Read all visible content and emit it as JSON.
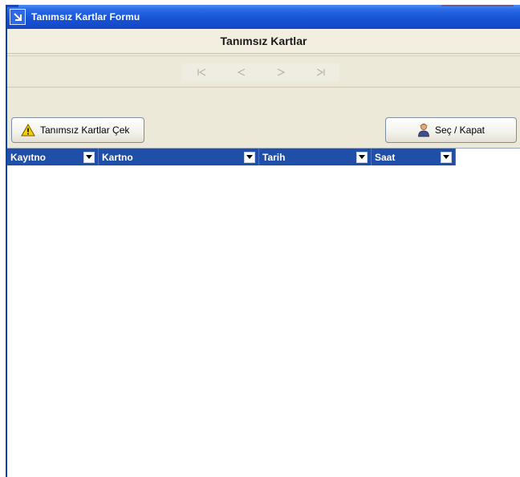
{
  "window": {
    "title": "Tanımsız Kartlar Formu",
    "icon": "arrow-down-right-icon"
  },
  "header": {
    "title": "Tanımsız Kartlar"
  },
  "navigator": {
    "buttons": [
      {
        "name": "first-record-icon"
      },
      {
        "name": "prior-record-icon"
      },
      {
        "name": "next-record-icon"
      },
      {
        "name": "last-record-icon"
      }
    ]
  },
  "toolbar": {
    "fetch_label": "Tanımsız Kartlar Çek",
    "fetch_icon": "warning-icon",
    "select_label": "Seç / Kapat",
    "select_icon": "user-icon"
  },
  "grid": {
    "columns": [
      "Kayıtno",
      "Kartno",
      "Tarih",
      "Saat"
    ],
    "rows": []
  },
  "colors": {
    "title_bar": "#1754d6",
    "grid_header": "#1f4fa8",
    "panel": "#ece9d8"
  }
}
